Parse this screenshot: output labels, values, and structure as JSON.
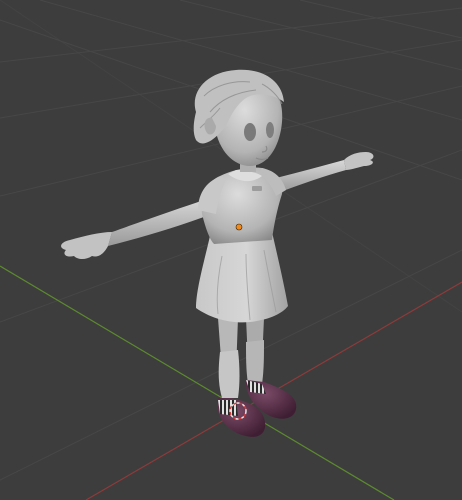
{
  "viewport": {
    "mode": "3d-viewport",
    "shading": "solid",
    "colors": {
      "background": "#3d3d3d",
      "grid_line": "#4a4a4a",
      "x_axis": "#8e3a3a",
      "y_axis": "#5c8a2e",
      "mesh_light": "#d2d2d2",
      "mesh_mid": "#a8a8a8",
      "mesh_shadow": "#7c7c7c",
      "shoe": "#5a2e48",
      "shoe_highlight": "#7a4a66",
      "sock_stripe": "#2a2a2a",
      "origin_dot": "#f08a1c",
      "cursor_ring": "#e6e6e6"
    }
  },
  "scene": {
    "object": "character-model-tpose",
    "icons": [
      "origin-point-icon",
      "3d-cursor-icon"
    ]
  }
}
